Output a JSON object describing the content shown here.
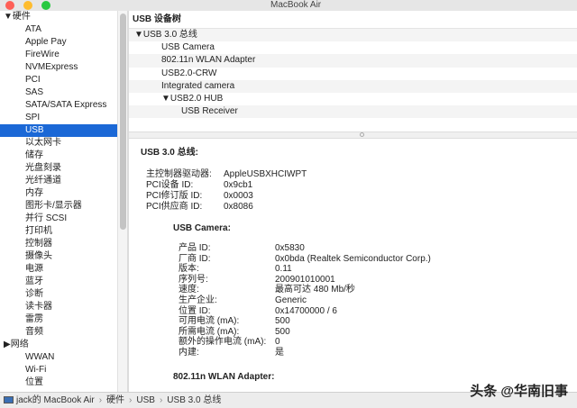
{
  "window": {
    "title": "MacBook Air"
  },
  "sidebar": {
    "items": [
      {
        "label": "▼硬件",
        "group": true
      },
      {
        "label": "ATA"
      },
      {
        "label": "Apple Pay"
      },
      {
        "label": "FireWire"
      },
      {
        "label": "NVMExpress"
      },
      {
        "label": "PCI"
      },
      {
        "label": "SAS"
      },
      {
        "label": "SATA/SATA Express"
      },
      {
        "label": "SPI"
      },
      {
        "label": "USB",
        "selected": true
      },
      {
        "label": "以太网卡"
      },
      {
        "label": "储存"
      },
      {
        "label": "光盘刻录"
      },
      {
        "label": "光纤通道"
      },
      {
        "label": "内存"
      },
      {
        "label": "图形卡/显示器"
      },
      {
        "label": "并行 SCSI"
      },
      {
        "label": "打印机"
      },
      {
        "label": "控制器"
      },
      {
        "label": "摄像头"
      },
      {
        "label": "电源"
      },
      {
        "label": "蓝牙"
      },
      {
        "label": "诊断"
      },
      {
        "label": "读卡器"
      },
      {
        "label": "雷雳"
      },
      {
        "label": "音频"
      },
      {
        "label": "▶网络",
        "group": true
      },
      {
        "label": "WWAN"
      },
      {
        "label": "Wi-Fi"
      },
      {
        "label": "位置"
      }
    ]
  },
  "tree": {
    "header": "USB 设备树",
    "rows": [
      {
        "label": "▼USB 3.0 总线",
        "indent": 0
      },
      {
        "label": "USB Camera",
        "indent": 1
      },
      {
        "label": "802.11n WLAN Adapter",
        "indent": 1
      },
      {
        "label": "USB2.0-CRW",
        "indent": 1
      },
      {
        "label": "Integrated camera",
        "indent": 1
      },
      {
        "label": "▼USB2.0 HUB",
        "indent": 1
      },
      {
        "label": "USB Receiver",
        "indent": 2
      },
      {
        "label": "",
        "indent": 0
      }
    ]
  },
  "detail": {
    "bus_title": "USB 3.0 总线:",
    "bus_props": [
      [
        "主控制器驱动器:",
        "AppleUSBXHCIWPT"
      ],
      [
        "PCI设备 ID:",
        "0x9cb1"
      ],
      [
        "PCI修订版 ID:",
        "0x0003"
      ],
      [
        "PCI供应商 ID:",
        "0x8086"
      ]
    ],
    "device_title": "USB Camera:",
    "device_props": [
      [
        "产品 ID:",
        "0x5830"
      ],
      [
        "厂商 ID:",
        "0x0bda  (Realtek Semiconductor Corp.)"
      ],
      [
        "版本:",
        "0.11"
      ],
      [
        "序列号:",
        "200901010001"
      ],
      [
        "速度:",
        "最高可达 480 Mb/秒"
      ],
      [
        "生产企业:",
        "Generic"
      ],
      [
        "位置 ID:",
        "0x14700000 / 6"
      ],
      [
        "可用电流 (mA):",
        "500"
      ],
      [
        "所需电流 (mA):",
        "500"
      ],
      [
        "额外的操作电流 (mA):",
        "0"
      ],
      [
        "内建:",
        "是"
      ]
    ],
    "next_title": "802.11n WLAN Adapter:"
  },
  "status": {
    "crumbs": [
      "jack的 MacBook Air",
      "硬件",
      "USB",
      "USB 3.0 总线"
    ]
  },
  "watermark": "头条 @华南旧事"
}
